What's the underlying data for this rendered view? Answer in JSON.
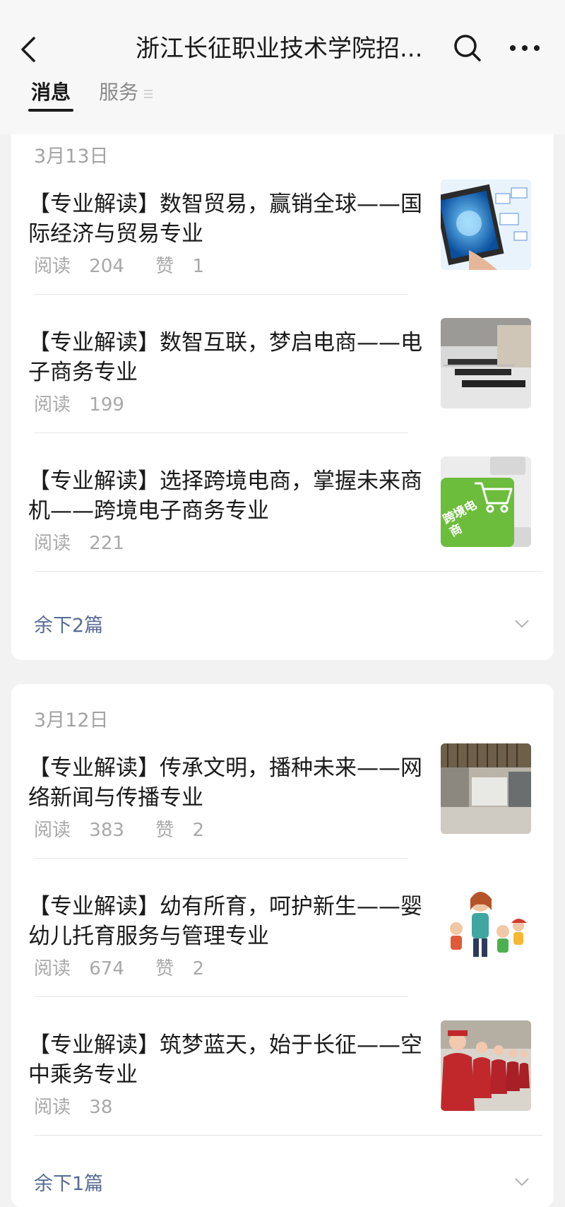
{
  "header": {
    "title": "浙江长征职业技术学院招...",
    "tabs": [
      {
        "label": "消息",
        "active": true
      },
      {
        "label": "服务",
        "active": false
      }
    ]
  },
  "icons": [
    "back-arrow-icon",
    "search-icon",
    "more-dots-icon",
    "menu-lines-icon",
    "chevron-down-icon"
  ],
  "colors": {
    "link": "#576b95",
    "meta": "#a8a8a8",
    "background": "#f2f2f2"
  },
  "groups": [
    {
      "date": "3月13日",
      "items": [
        {
          "title": "【专业解读】数智贸易，赢销全球——国际经济与贸易专业",
          "read_label": "阅读",
          "read": "204",
          "like_label": "赞",
          "like": "1"
        },
        {
          "title": "【专业解读】数智互联，梦启电商——电子商务专业",
          "read_label": "阅读",
          "read": "199",
          "like_label": "",
          "like": ""
        },
        {
          "title": "【专业解读】选择跨境电商，掌握未来商机——跨境电子商务专业",
          "read_label": "阅读",
          "read": "221",
          "like_label": "",
          "like": "",
          "thumb_text": "跨境电商"
        }
      ],
      "more": "余下2篇"
    },
    {
      "date": "3月12日",
      "items": [
        {
          "title": "【专业解读】传承文明，播种未来——网络新闻与传播专业",
          "read_label": "阅读",
          "read": "383",
          "like_label": "赞",
          "like": "2"
        },
        {
          "title": "【专业解读】幼有所育，呵护新生——婴幼儿托育服务与管理专业",
          "read_label": "阅读",
          "read": "674",
          "like_label": "赞",
          "like": "2"
        },
        {
          "title": "【专业解读】筑梦蓝天，始于长征——空中乘务专业",
          "read_label": "阅读",
          "read": "38",
          "like_label": "",
          "like": ""
        }
      ],
      "more": "余下1篇"
    }
  ]
}
